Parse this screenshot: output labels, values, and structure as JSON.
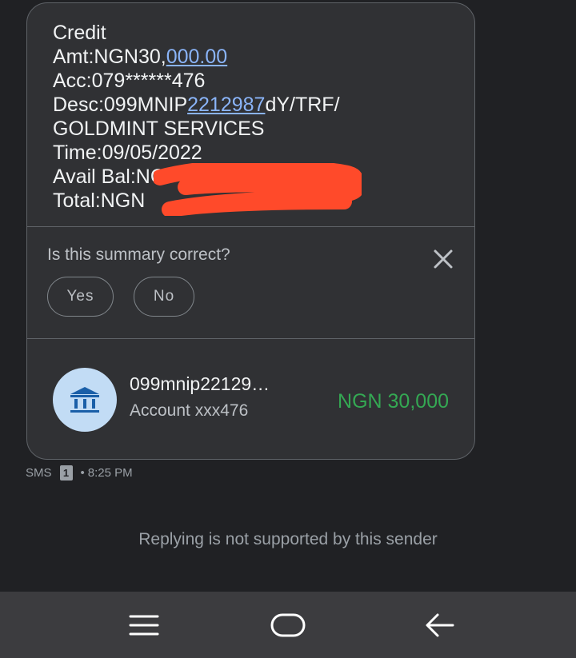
{
  "message": {
    "lines": {
      "l1": "Credit",
      "l2_prefix": "Amt:NGN30,",
      "l2_link": "000.00",
      "l3": "Acc:079******476",
      "l4_prefix": "Desc:099MNIP",
      "l4_link": "2212987",
      "l4_suffix": "dY/TRF/",
      "l5": "GOLDMINT SERVICES",
      "l6": "Time:09/05/2022",
      "l7": "Avail Bal:NG",
      "l8": "Total:NGN"
    }
  },
  "feedback": {
    "question": "Is this summary correct?",
    "yes_label": "Yes",
    "no_label": "No"
  },
  "transaction": {
    "sender": "099mnip22129…",
    "account": "Account xxx476",
    "amount": "NGN 30,000",
    "icon": "bank-icon"
  },
  "meta": {
    "channel": "SMS",
    "sim": "1",
    "time": "8:25 PM"
  },
  "reply_note": "Replying is not supported by this sender",
  "colors": {
    "bubble": "#303134",
    "link": "#8ab4f8",
    "amount": "#34a853",
    "redaction": "#ff4a2a"
  }
}
